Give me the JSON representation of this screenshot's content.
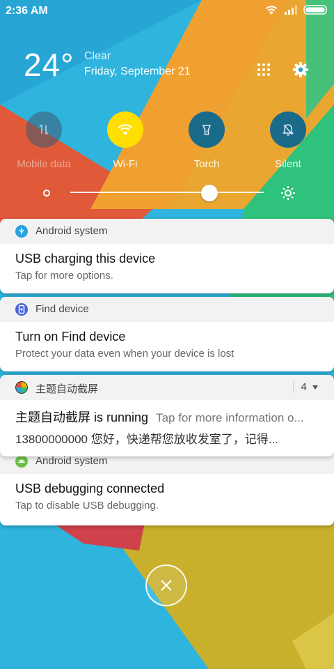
{
  "status_bar": {
    "time": "2:36 AM",
    "icons": [
      "wifi-icon",
      "signal-icon",
      "battery-icon"
    ]
  },
  "weather": {
    "temperature": "24°",
    "condition": "Clear",
    "date": "Friday, September 21"
  },
  "header_buttons": [
    "grid-icon",
    "gear-icon"
  ],
  "quick_tiles": [
    {
      "label": "Mobile data",
      "icon": "mobile-data-icon",
      "state": "off"
    },
    {
      "label": "Wi-Fi",
      "icon": "wifi-icon",
      "state": "on"
    },
    {
      "label": "Torch",
      "icon": "torch-icon",
      "state": "off"
    },
    {
      "label": "Silent",
      "icon": "bell-off-icon",
      "state": "off"
    }
  ],
  "brightness": {
    "level": 0.72
  },
  "notifications": [
    {
      "app": "Android system",
      "title": "USB charging this device",
      "subtitle": "Tap for more options."
    },
    {
      "app": "Find device",
      "title": "Turn on Find device",
      "subtitle": "Protect your data even when your device is lost"
    },
    {
      "app": "主题自动截屏",
      "count": "4",
      "title": "主题自动截屏 is running",
      "title_extra": "Tap for more information o...",
      "subtitle": "13800000000 您好，快递帮您放收发室了，记得..."
    },
    {
      "app": "Android system",
      "title": "USB debugging connected",
      "subtitle": "Tap to disable USB debugging."
    }
  ],
  "colors": {
    "accent_yellow": "#ffde00",
    "tile_off": "#1a6a8a",
    "wall_red": "#e05a3a",
    "wall_orange": "#f0a030",
    "wall_green": "#2ec27c",
    "wall_blue": "#2fb4dd",
    "wall_olive": "#c9b02c"
  }
}
